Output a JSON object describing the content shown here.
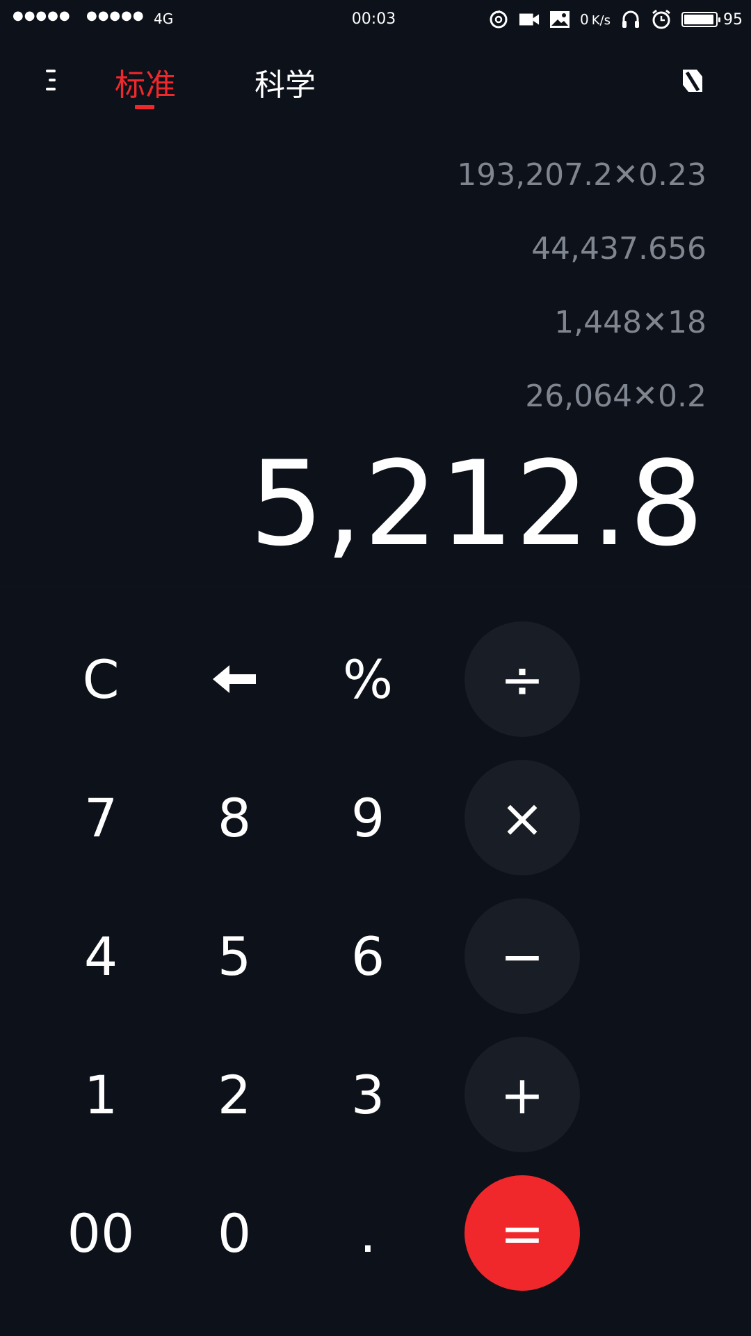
{
  "status_bar": {
    "signal1": "●●●●●",
    "signal2": "●●●●●",
    "network": "4G",
    "time": "00:03",
    "speed_value": "0",
    "speed_unit": "K/s",
    "battery_percent": 95,
    "battery_text": "95",
    "icons": [
      "netease-music-icon",
      "video-icon",
      "image-icon",
      "headphones-icon",
      "alarm-icon",
      "battery-icon"
    ]
  },
  "header": {
    "tabs": [
      {
        "label": "标准",
        "active": true
      },
      {
        "label": "科学",
        "active": false
      }
    ],
    "menu_icon": "menu-icon",
    "theme_icon": "theme-toggle-icon"
  },
  "display": {
    "history": [
      "193,207.2✕0.23",
      "44,437.656",
      "1,448✕18",
      "26,064✕0.2"
    ],
    "result": "5,212.8"
  },
  "keypad": {
    "rows": [
      [
        "C",
        "",
        "%",
        "÷"
      ],
      [
        "7",
        "8",
        "9",
        "×"
      ],
      [
        "4",
        "5",
        "6",
        "−"
      ],
      [
        "1",
        "2",
        "3",
        "+"
      ],
      [
        "00",
        "0",
        ".",
        "="
      ]
    ],
    "backspace_icon": "backspace-arrow-icon"
  },
  "colors": {
    "background": "#0d1119",
    "accent": "#f0282c",
    "operator_bg": "#191d25",
    "history_text": "#808690"
  }
}
